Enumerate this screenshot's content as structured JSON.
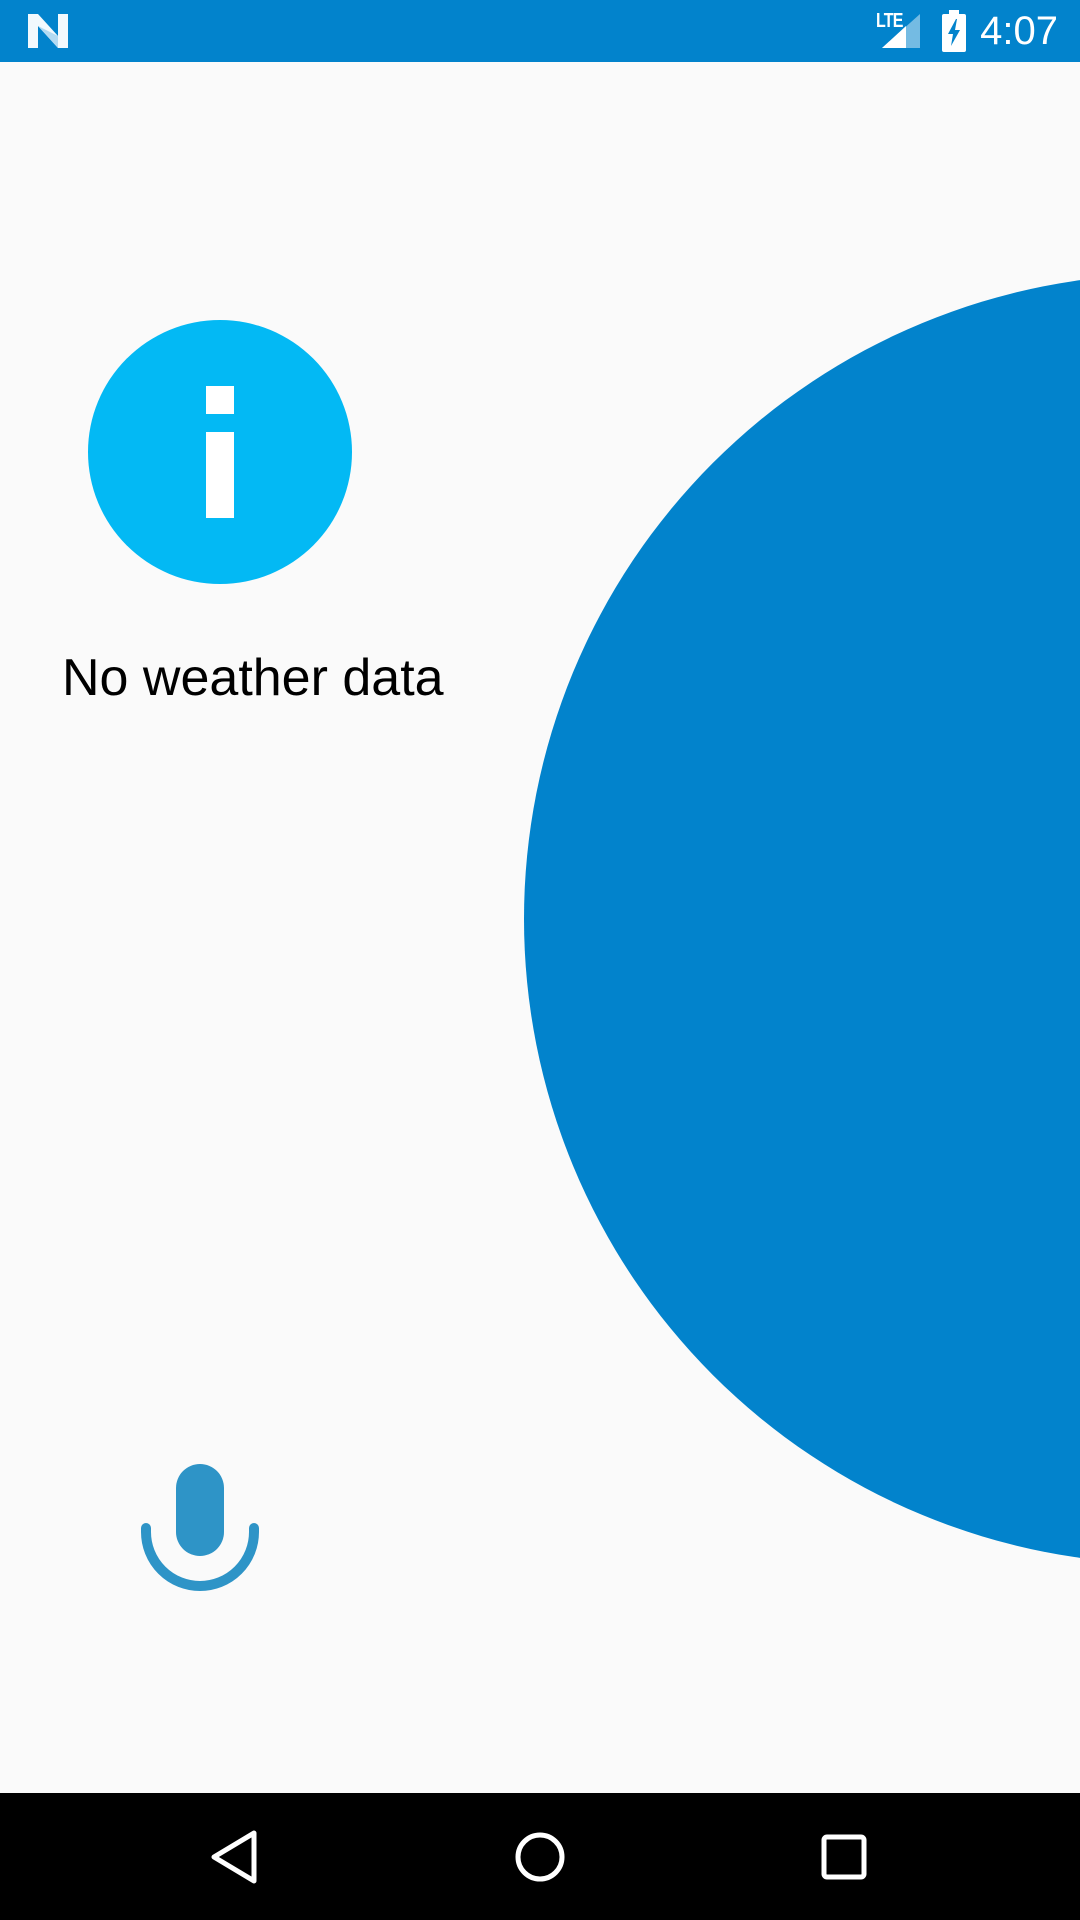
{
  "status_bar": {
    "network_type": "LTE",
    "time": "4:07",
    "background_color": "#0283CC",
    "icons": [
      "app-logo-icon",
      "signal-icon",
      "battery-charging-icon"
    ]
  },
  "main": {
    "message": "No weather data",
    "info_icon_color": "#03B9F4",
    "circle_color": "#0283CC",
    "mic_color": "#2E94C7",
    "icons": [
      "info-icon",
      "microphone-icon"
    ]
  },
  "nav_bar": {
    "buttons": [
      "back-icon",
      "home-icon",
      "recents-icon"
    ]
  }
}
